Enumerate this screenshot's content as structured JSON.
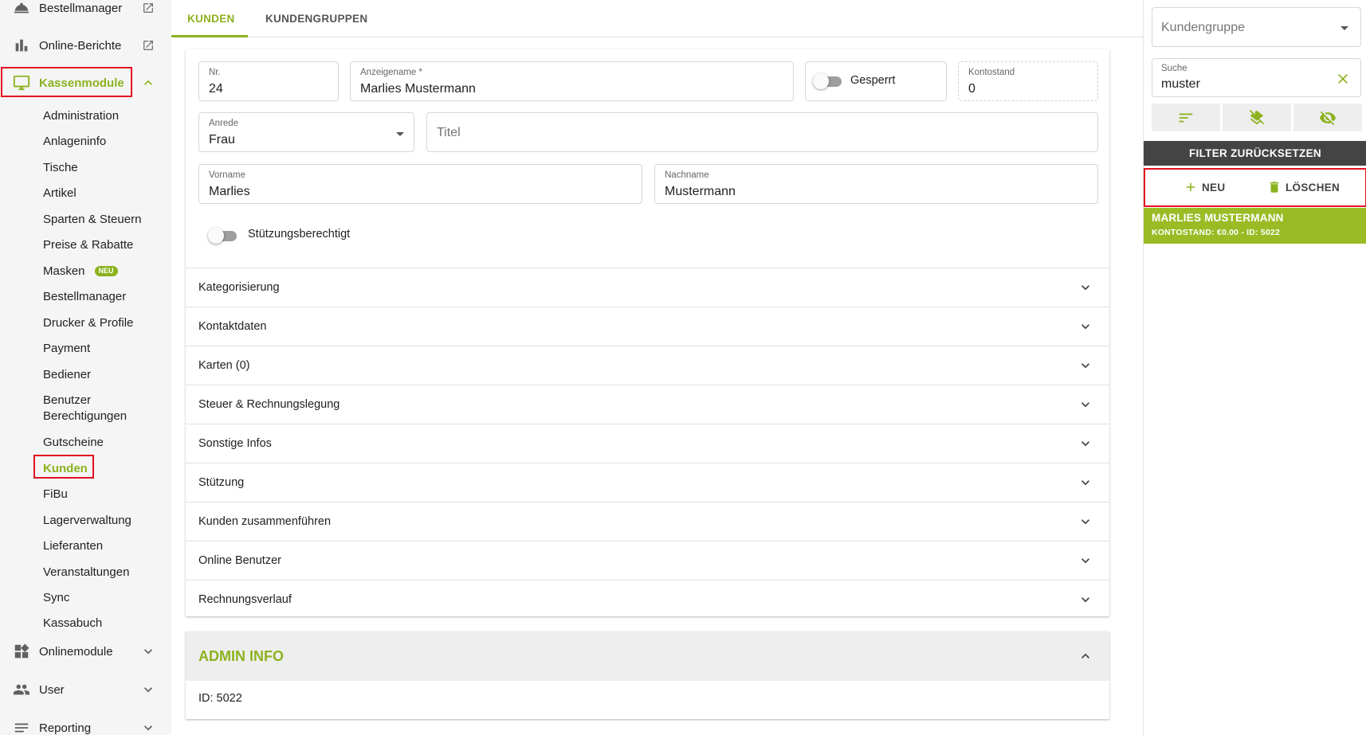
{
  "sidebar": {
    "top_items": [
      {
        "label": "Bestellmanager"
      },
      {
        "label": "Online-Berichte"
      }
    ],
    "section": {
      "label": "Kassenmodule"
    },
    "sub_items": [
      {
        "label": "Administration"
      },
      {
        "label": "Anlageninfo"
      },
      {
        "label": "Tische"
      },
      {
        "label": "Artikel"
      },
      {
        "label": "Sparten & Steuern"
      },
      {
        "label": "Preise & Rabatte"
      },
      {
        "label": "Masken",
        "badge": "NEU"
      },
      {
        "label": "Bestellmanager"
      },
      {
        "label": "Drucker & Profile"
      },
      {
        "label": "Payment"
      },
      {
        "label": "Bediener"
      },
      {
        "label": "Benutzer",
        "label2": "Berechtigungen"
      },
      {
        "label": "Gutscheine"
      },
      {
        "label": "Kunden"
      },
      {
        "label": "FiBu"
      },
      {
        "label": "Lagerverwaltung"
      },
      {
        "label": "Lieferanten"
      },
      {
        "label": "Veranstaltungen"
      },
      {
        "label": "Sync"
      },
      {
        "label": "Kassabuch"
      }
    ],
    "bottom_items": [
      {
        "label": "Onlinemodule"
      },
      {
        "label": "User"
      },
      {
        "label": "Reporting"
      }
    ]
  },
  "tabs": [
    {
      "label": "KUNDEN"
    },
    {
      "label": "KUNDENGRUPPEN"
    }
  ],
  "form": {
    "nr": {
      "label": "Nr.",
      "value": "24"
    },
    "anzeigename": {
      "label": "Anzeigename *",
      "value": "Marlies Mustermann"
    },
    "gesperrt": {
      "label": "Gesperrt"
    },
    "kontostand": {
      "label": "Kontostand",
      "value": "0"
    },
    "anrede": {
      "label": "Anrede",
      "value": "Frau"
    },
    "titel": {
      "placeholder": "Titel"
    },
    "vorname": {
      "label": "Vorname",
      "value": "Marlies"
    },
    "nachname": {
      "label": "Nachname",
      "value": "Mustermann"
    },
    "stuetzung": {
      "label": "Stützungsberechtigt"
    }
  },
  "accordion": [
    {
      "label": "Kategorisierung"
    },
    {
      "label": "Kontaktdaten"
    },
    {
      "label": "Karten (0)"
    },
    {
      "label": "Steuer & Rechnungslegung"
    },
    {
      "label": "Sonstige Infos"
    },
    {
      "label": "Stützung"
    },
    {
      "label": "Kunden zusammenführen"
    },
    {
      "label": "Online Benutzer"
    },
    {
      "label": "Rechnungsverlauf"
    }
  ],
  "admin": {
    "title": "ADMIN INFO",
    "id_text": "ID: 5022"
  },
  "right": {
    "kundengruppe": {
      "placeholder": "Kundengruppe"
    },
    "suche": {
      "label": "Suche",
      "value": "muster"
    },
    "filter_reset": "FILTER ZURÜCKSETZEN",
    "new_label": "NEU",
    "delete_label": "LÖSCHEN",
    "customer": {
      "name": "MARLIES MUSTERMANN",
      "info": "KONTOSTAND: €0.00 - ID: 5022"
    }
  },
  "colors": {
    "accent": "#8cb21f",
    "highlight": "#e3101e",
    "dark": "#444444"
  }
}
